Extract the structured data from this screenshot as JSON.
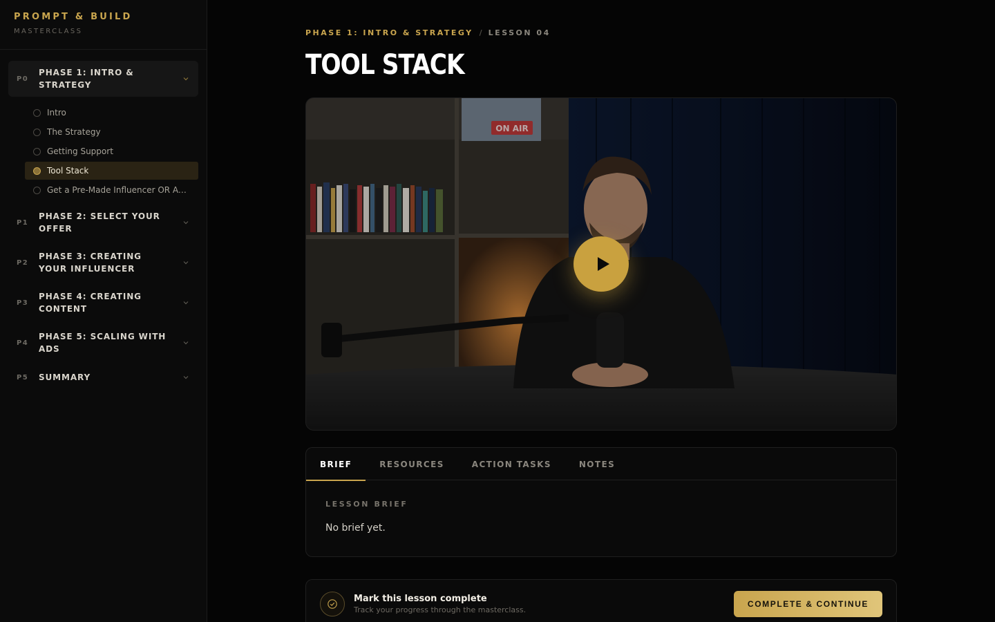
{
  "brand": {
    "title": "PROMPT & BUILD",
    "subtitle": "MASTERCLASS"
  },
  "sidebar": {
    "phases": [
      {
        "code": "P0",
        "name": "PHASE 1: INTRO & STRATEGY",
        "expanded": true,
        "lessons": [
          {
            "label": "Intro",
            "active": false
          },
          {
            "label": "The Strategy",
            "active": false
          },
          {
            "label": "Getting Support",
            "active": false
          },
          {
            "label": "Tool Stack",
            "active": true
          },
          {
            "label": "Get a Pre-Made Influencer OR Att...",
            "active": false
          }
        ]
      },
      {
        "code": "P1",
        "name": "PHASE 2: SELECT YOUR OFFER",
        "expanded": false
      },
      {
        "code": "P2",
        "name": "PHASE 3: CREATING YOUR INFLUENCER",
        "expanded": false
      },
      {
        "code": "P3",
        "name": "PHASE 4: CREATING CONTENT",
        "expanded": false
      },
      {
        "code": "P4",
        "name": "PHASE 5: SCALING WITH ADS",
        "expanded": false
      },
      {
        "code": "P5",
        "name": "SUMMARY",
        "expanded": false
      }
    ]
  },
  "breadcrumb": {
    "phase": "PHASE 1: INTRO & STRATEGY",
    "separator": "/",
    "lesson": "LESSON 04"
  },
  "page_title": "TOOL STACK",
  "video": {
    "play_icon": "play-icon",
    "sign_text": "ON AIR"
  },
  "tabs": [
    {
      "label": "BRIEF",
      "active": true
    },
    {
      "label": "RESOURCES",
      "active": false
    },
    {
      "label": "ACTION TASKS",
      "active": false
    },
    {
      "label": "NOTES",
      "active": false
    }
  ],
  "brief": {
    "label": "LESSON BRIEF",
    "text": "No brief yet."
  },
  "completion": {
    "title": "Mark this lesson complete",
    "subtitle": "Track your progress through the masterclass.",
    "button": "COMPLETE & CONTINUE"
  },
  "colors": {
    "accent": "#c9a54e",
    "background": "#050505",
    "sidebar": "#0b0b0b"
  }
}
